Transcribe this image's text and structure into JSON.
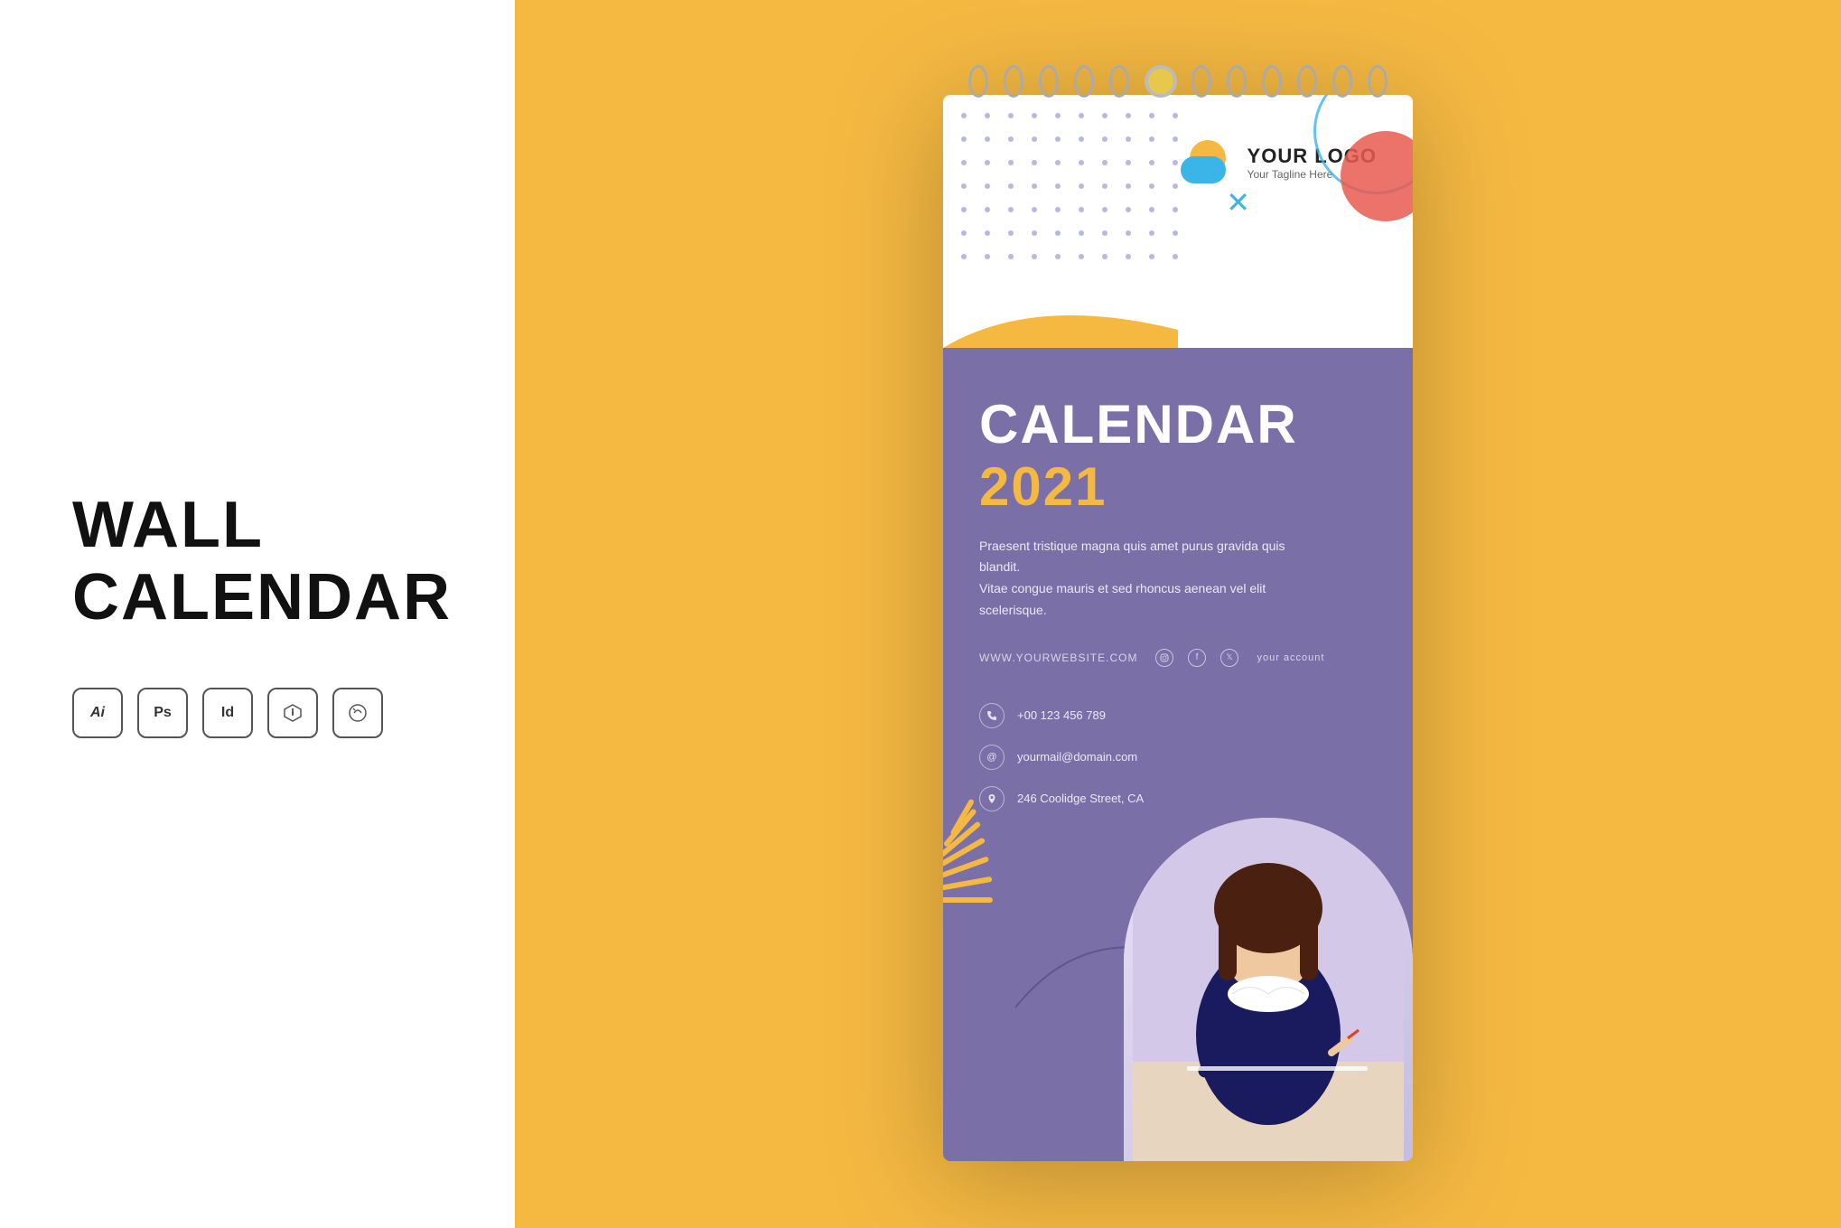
{
  "leftPanel": {
    "title_line1": "WALL",
    "title_line2": "CALENDAR",
    "softwareIcons": [
      {
        "label": "Ai",
        "id": "ai"
      },
      {
        "label": "Ps",
        "id": "ps"
      },
      {
        "label": "Id",
        "id": "id"
      },
      {
        "label": "♦",
        "id": "pdf"
      },
      {
        "label": "✂",
        "id": "corel"
      }
    ]
  },
  "calendar": {
    "logo": {
      "brand": "YOUR LOGO",
      "tagline": "Your Tagline Here"
    },
    "title": "CALENDAR",
    "year": "2021",
    "description": "Praesent tristique magna quis amet purus gravida quis blandit.\nVitae congue mauris et sed rhoncus aenean vel elit scelerisque.",
    "website": "WWW.YOURWEBSITE.COM",
    "socialAccount": "your account",
    "contacts": [
      {
        "icon": "📞",
        "type": "phone",
        "value": "+00 123 456 789"
      },
      {
        "icon": "@",
        "type": "email",
        "value": "yourmail@domain.com"
      },
      {
        "icon": "📍",
        "type": "address",
        "value": "246 Coolidge Street, CA"
      }
    ]
  },
  "colors": {
    "accent_yellow": "#F5B942",
    "accent_purple": "#7B6FA8",
    "accent_blue": "#3BB5E8",
    "accent_red": "#E85A4F",
    "dot_purple": "#8888cc"
  }
}
